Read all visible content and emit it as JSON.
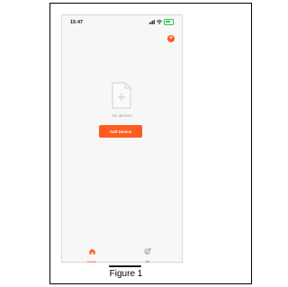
{
  "status_bar": {
    "time": "15:47"
  },
  "main": {
    "empty_label": "No devices",
    "add_device_label": "Add Device",
    "add_icon_glyph": "+"
  },
  "tab_bar": {
    "items": [
      {
        "label": "Home",
        "icon": "home-icon",
        "active": true
      },
      {
        "label": "Me",
        "icon": "profile-icon",
        "active": false
      }
    ]
  },
  "caption": "Figure 1",
  "colors": {
    "accent": "#ff5a1f",
    "background": "#f7f7f8"
  }
}
